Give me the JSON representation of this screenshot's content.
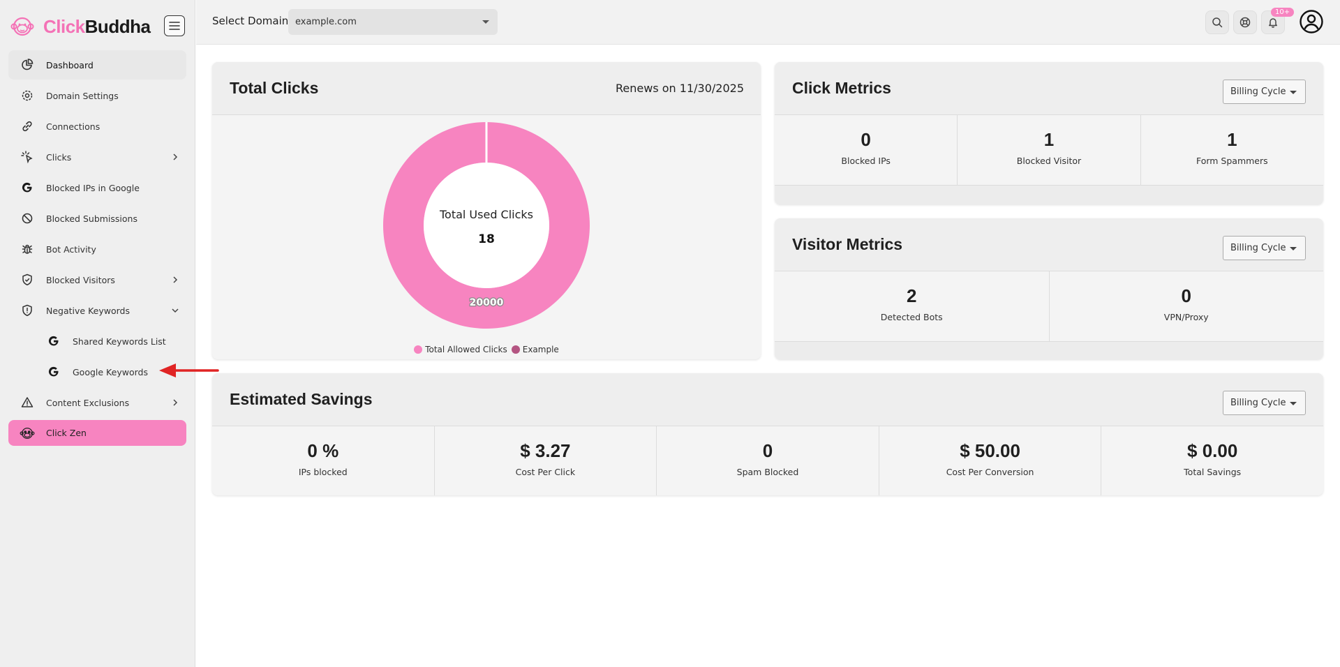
{
  "brand": {
    "click": "Click",
    "buddha": "Buddha"
  },
  "sidebar": {
    "items": [
      {
        "label": "Dashboard",
        "icon": "pie-chart-icon"
      },
      {
        "label": "Domain Settings",
        "icon": "settings-icon"
      },
      {
        "label": "Connections",
        "icon": "link-icon"
      },
      {
        "label": "Clicks",
        "icon": "pointer-click-icon"
      },
      {
        "label": "Blocked IPs in Google",
        "icon": "google-icon"
      },
      {
        "label": "Blocked Submissions",
        "icon": "ban-icon"
      },
      {
        "label": "Bot Activity",
        "icon": "bug-icon"
      },
      {
        "label": "Blocked Visitors",
        "icon": "shield-check-icon"
      },
      {
        "label": "Negative Keywords",
        "icon": "shield-alert-icon"
      },
      {
        "label": "Shared Keywords List",
        "icon": "google-icon"
      },
      {
        "label": "Google Keywords",
        "icon": "google-icon"
      },
      {
        "label": "Content Exclusions",
        "icon": "warning-icon"
      },
      {
        "label": "Click Zen",
        "icon": "monkey-icon"
      }
    ]
  },
  "topbar": {
    "domain_label": "Select Domain",
    "domain_value": "example.com",
    "notification_badge": "10+"
  },
  "total_clicks": {
    "title": "Total Clicks",
    "renews": "Renews on 11/30/2025",
    "center_label": "Total Used Clicks",
    "center_value": "18",
    "ring_label": "20000"
  },
  "chart_data": {
    "type": "pie",
    "donut": true,
    "categories": [
      "Total Allowed Clicks",
      "Example"
    ],
    "values": [
      20000,
      18
    ],
    "colors": [
      "#f784c0",
      "#b45582"
    ],
    "legend": "bottom"
  },
  "click_metrics": {
    "title": "Click Metrics",
    "billing": "Billing Cycle",
    "items": [
      {
        "value": "0",
        "label": "Blocked IPs"
      },
      {
        "value": "1",
        "label": "Blocked Visitor"
      },
      {
        "value": "1",
        "label": "Form Spammers"
      }
    ]
  },
  "visitor_metrics": {
    "title": "Visitor Metrics",
    "billing": "Billing Cycle",
    "items": [
      {
        "value": "2",
        "label": "Detected Bots"
      },
      {
        "value": "0",
        "label": "VPN/Proxy"
      }
    ]
  },
  "savings": {
    "title": "Estimated Savings",
    "billing": "Billing Cycle",
    "items": [
      {
        "value": "0 %",
        "label": "IPs blocked"
      },
      {
        "value": "$ 3.27",
        "label": "Cost Per Click"
      },
      {
        "value": "0",
        "label": "Spam Blocked"
      },
      {
        "value": "$ 50.00",
        "label": "Cost Per Conversion"
      },
      {
        "value": "$ 0.00",
        "label": "Total Savings"
      }
    ]
  },
  "colors": {
    "accent": "#f784c0",
    "accent_dark": "#b45582",
    "annotation_arrow": "#e02424"
  }
}
